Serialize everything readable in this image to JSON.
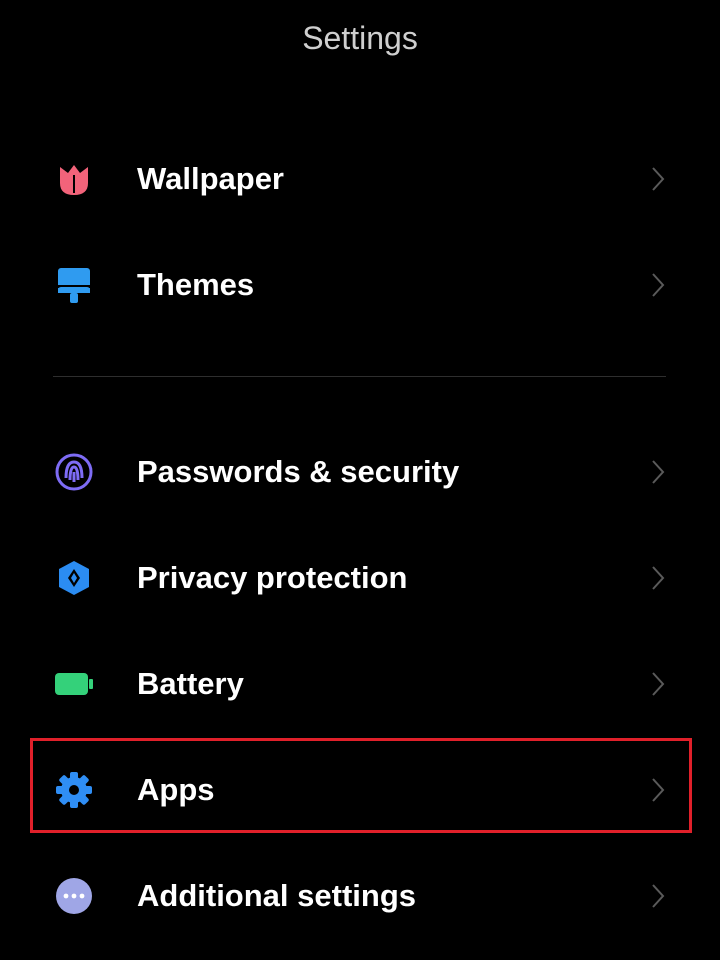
{
  "header": {
    "title": "Settings"
  },
  "sections": [
    {
      "items": [
        {
          "label": "Wallpaper",
          "icon": "tulip-icon",
          "icon_color": "#f2637a"
        },
        {
          "label": "Themes",
          "icon": "paint-brush-icon",
          "icon_color": "#2f9bf0"
        }
      ]
    },
    {
      "items": [
        {
          "label": "Passwords & security",
          "icon": "fingerprint-icon",
          "icon_color": "#7e6cf5"
        },
        {
          "label": "Privacy protection",
          "icon": "privacy-shield-icon",
          "icon_color": "#2b8cf2"
        },
        {
          "label": "Battery",
          "icon": "battery-icon",
          "icon_color": "#34d17a"
        },
        {
          "label": "Apps",
          "icon": "gear-icon",
          "icon_color": "#2f8ef5",
          "highlighted": true
        },
        {
          "label": "Additional settings",
          "icon": "more-dots-icon",
          "icon_color": "#9fa6e6"
        }
      ]
    }
  ],
  "colors": {
    "background": "#000000",
    "highlight_border": "#e0202a",
    "chevron": "#5a5a5a"
  }
}
